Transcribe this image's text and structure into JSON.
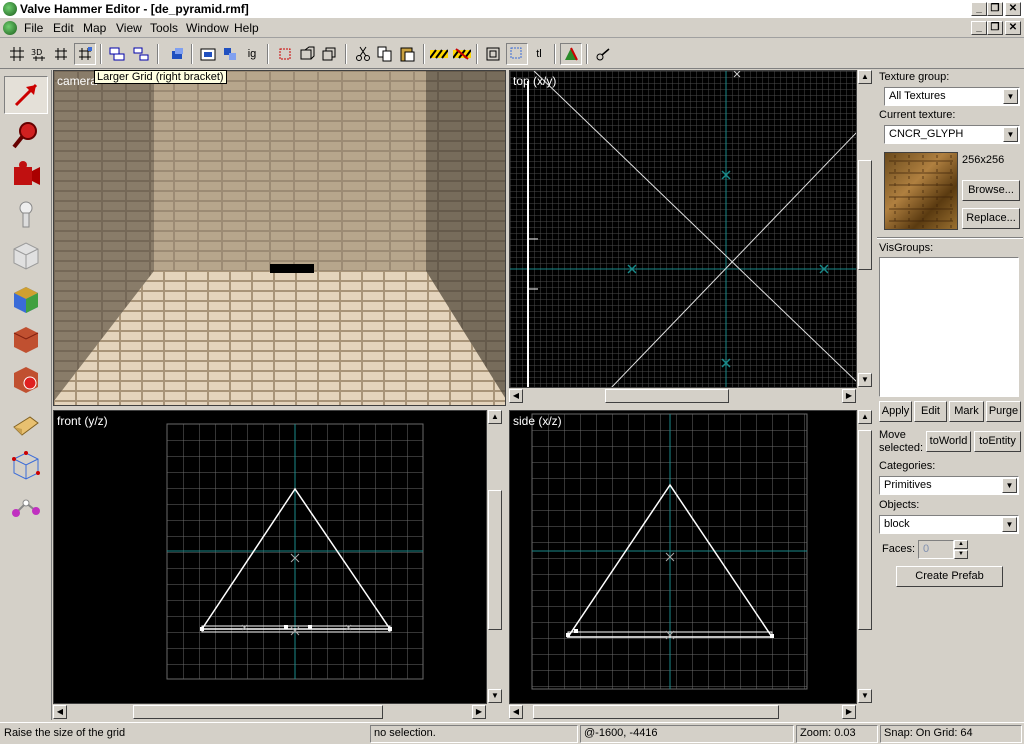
{
  "window": {
    "title": "Valve Hammer Editor - [de_pyramid.rmf]"
  },
  "menu": [
    "File",
    "Edit",
    "Map",
    "View",
    "Tools",
    "Window",
    "Help"
  ],
  "toolbar_icons": [
    "grid-icon",
    "3d-grid-icon",
    "smaller-grid-icon",
    "larger-grid-icon",
    "group-icon",
    "ungroup-icon",
    "tie-entity-icon",
    "carve-icon",
    "hollow-icon",
    "texture-lock-icon",
    "ig",
    "flip-icon",
    "mirror-icon",
    "copy-selection-icon",
    "cut-icon",
    "copy-icon",
    "paste-icon",
    "hide-selection-icon",
    "unhide-icon",
    "selection-box-icon",
    "vertex-manip-icon",
    "tl",
    "run-map-icon",
    "options-icon"
  ],
  "toolbar": {
    "ig_label": "ig",
    "tl_label": "tl"
  },
  "tooltip": "Larger Grid (right bracket)",
  "tools": [
    "selection-tool",
    "magnify-tool",
    "camera-tool",
    "entity-tool",
    "block-tool",
    "texture-application-tool",
    "apply-current-texture-tool",
    "decal-tool",
    "clip-tool",
    "vertex-manipulation-tool",
    "path-tool"
  ],
  "viewports": {
    "camera": "camera",
    "top": "top (x/y)",
    "front": "front (y/z)",
    "side": "side (x/z)"
  },
  "panel": {
    "texture_group_label": "Texture group:",
    "texture_group_value": "All Textures",
    "current_texture_label": "Current texture:",
    "current_texture_value": "CNCR_GLYPH",
    "texture_size": "256x256",
    "browse": "Browse...",
    "replace": "Replace...",
    "visgroups_label": "VisGroups:",
    "apply": "Apply",
    "edit": "Edit",
    "mark": "Mark",
    "purge": "Purge",
    "move_selected_label": "Move selected:",
    "to_world": "toWorld",
    "to_entity": "toEntity",
    "categories_label": "Categories:",
    "categories_value": "Primitives",
    "objects_label": "Objects:",
    "objects_value": "block",
    "faces_label": "Faces:",
    "faces_value": "0",
    "create_prefab": "Create Prefab"
  },
  "status": {
    "hint": "Raise the size of the grid",
    "selection": "no selection.",
    "coords": "@-1600, -4416",
    "zoom": "Zoom: 0.03",
    "snap": "Snap: On Grid: 64"
  },
  "colors": {
    "accent_cyan": "#1a8a8a",
    "grid": "#5a5a5a",
    "brush": "#ffffff"
  }
}
